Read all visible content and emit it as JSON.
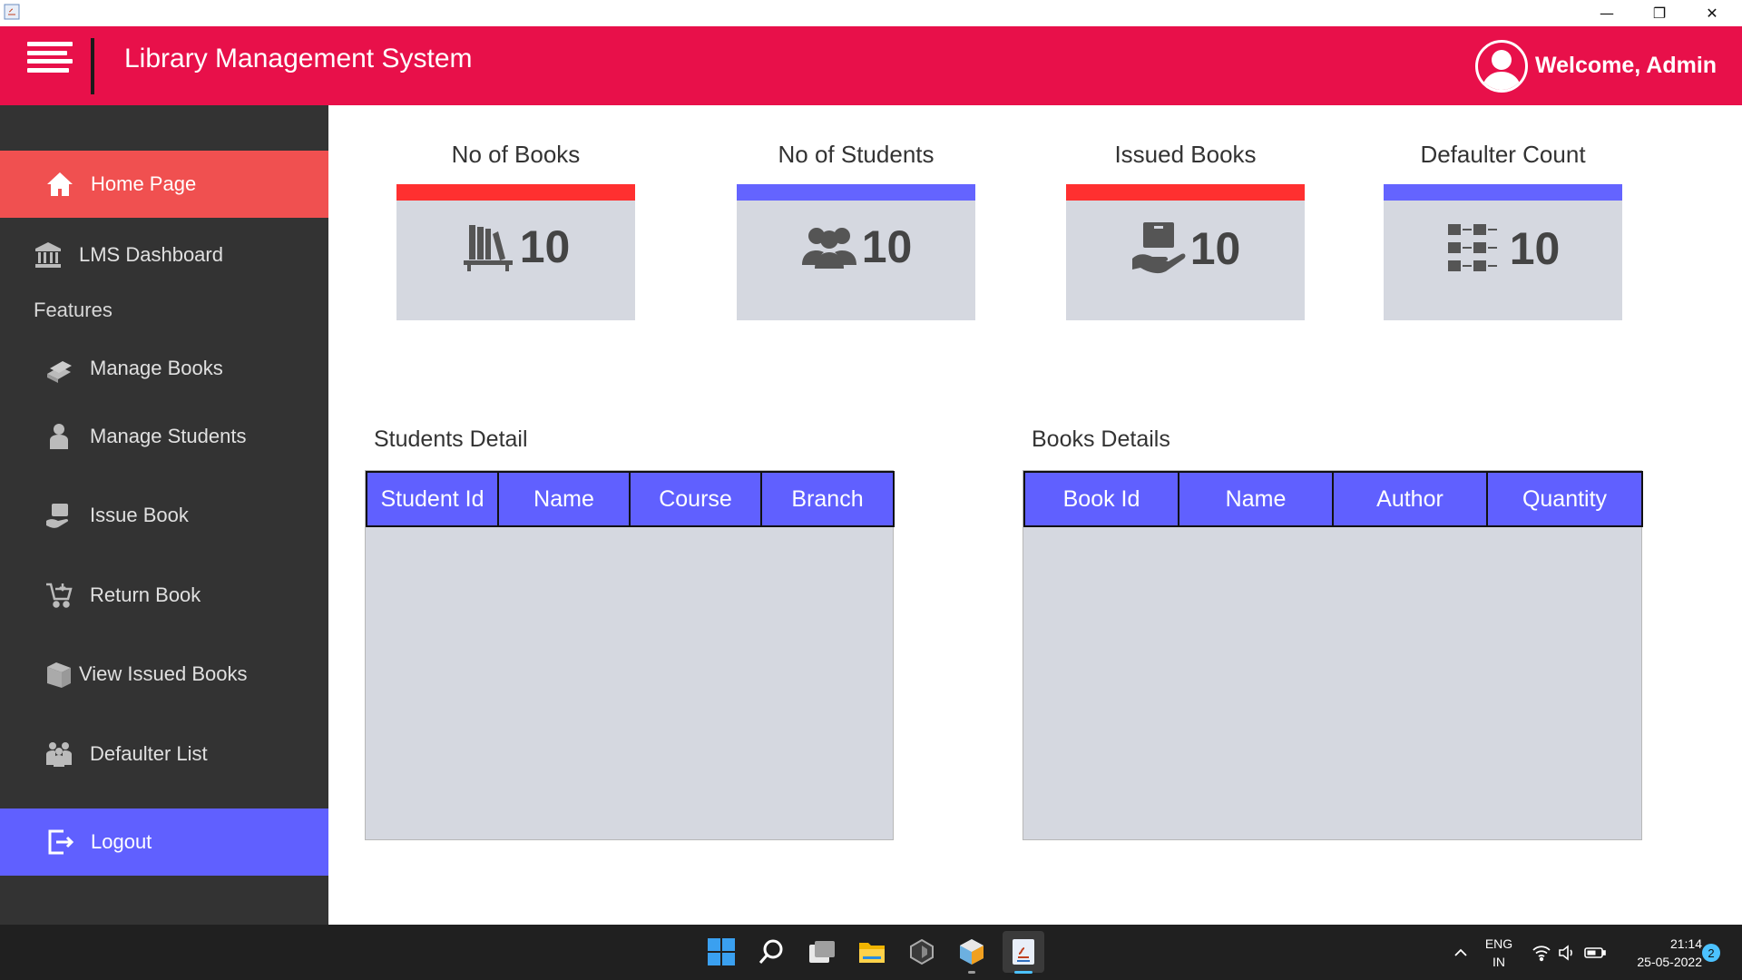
{
  "window": {
    "minimize_glyph": "—",
    "restore_glyph": "❐",
    "close_glyph": "✕"
  },
  "header": {
    "title": "Library Management System",
    "welcome": "Welcome, Admin",
    "color": "#e8104a"
  },
  "sidebar": {
    "home": "Home Page",
    "dashboard": "LMS Dashboard",
    "section": "Features",
    "manage_books": "Manage Books",
    "manage_students": "Manage Students",
    "issue_book": "Issue Book",
    "return_book": "Return Book",
    "view_issued": "View Issued Books",
    "defaulter_list": "Defaulter List",
    "logout": "Logout",
    "active_color": "#f05050",
    "logout_color": "#6060ff"
  },
  "cards": [
    {
      "title": "No of Books",
      "value": "10",
      "icon": "books-shelf-icon",
      "bar_color": "#ff3030"
    },
    {
      "title": "No of Students",
      "value": "10",
      "icon": "people-icon",
      "bar_color": "#6464ff"
    },
    {
      "title": "Issued Books",
      "value": "10",
      "icon": "hand-book-icon",
      "bar_color": "#ff3030"
    },
    {
      "title": "Defaulter Count",
      "value": "10",
      "icon": "list-icon",
      "bar_color": "#6464ff"
    }
  ],
  "students_table": {
    "title": "Students Detail",
    "columns": [
      "Student Id",
      "Name",
      "Course",
      "Branch"
    ],
    "rows": []
  },
  "books_table": {
    "title": "Books Details",
    "columns": [
      "Book Id",
      "Name",
      "Author",
      "Quantity"
    ],
    "rows": []
  },
  "taskbar": {
    "lang": "ENG",
    "region": "IN",
    "time": "21:14",
    "date": "25-05-2022",
    "notifications": "2"
  }
}
